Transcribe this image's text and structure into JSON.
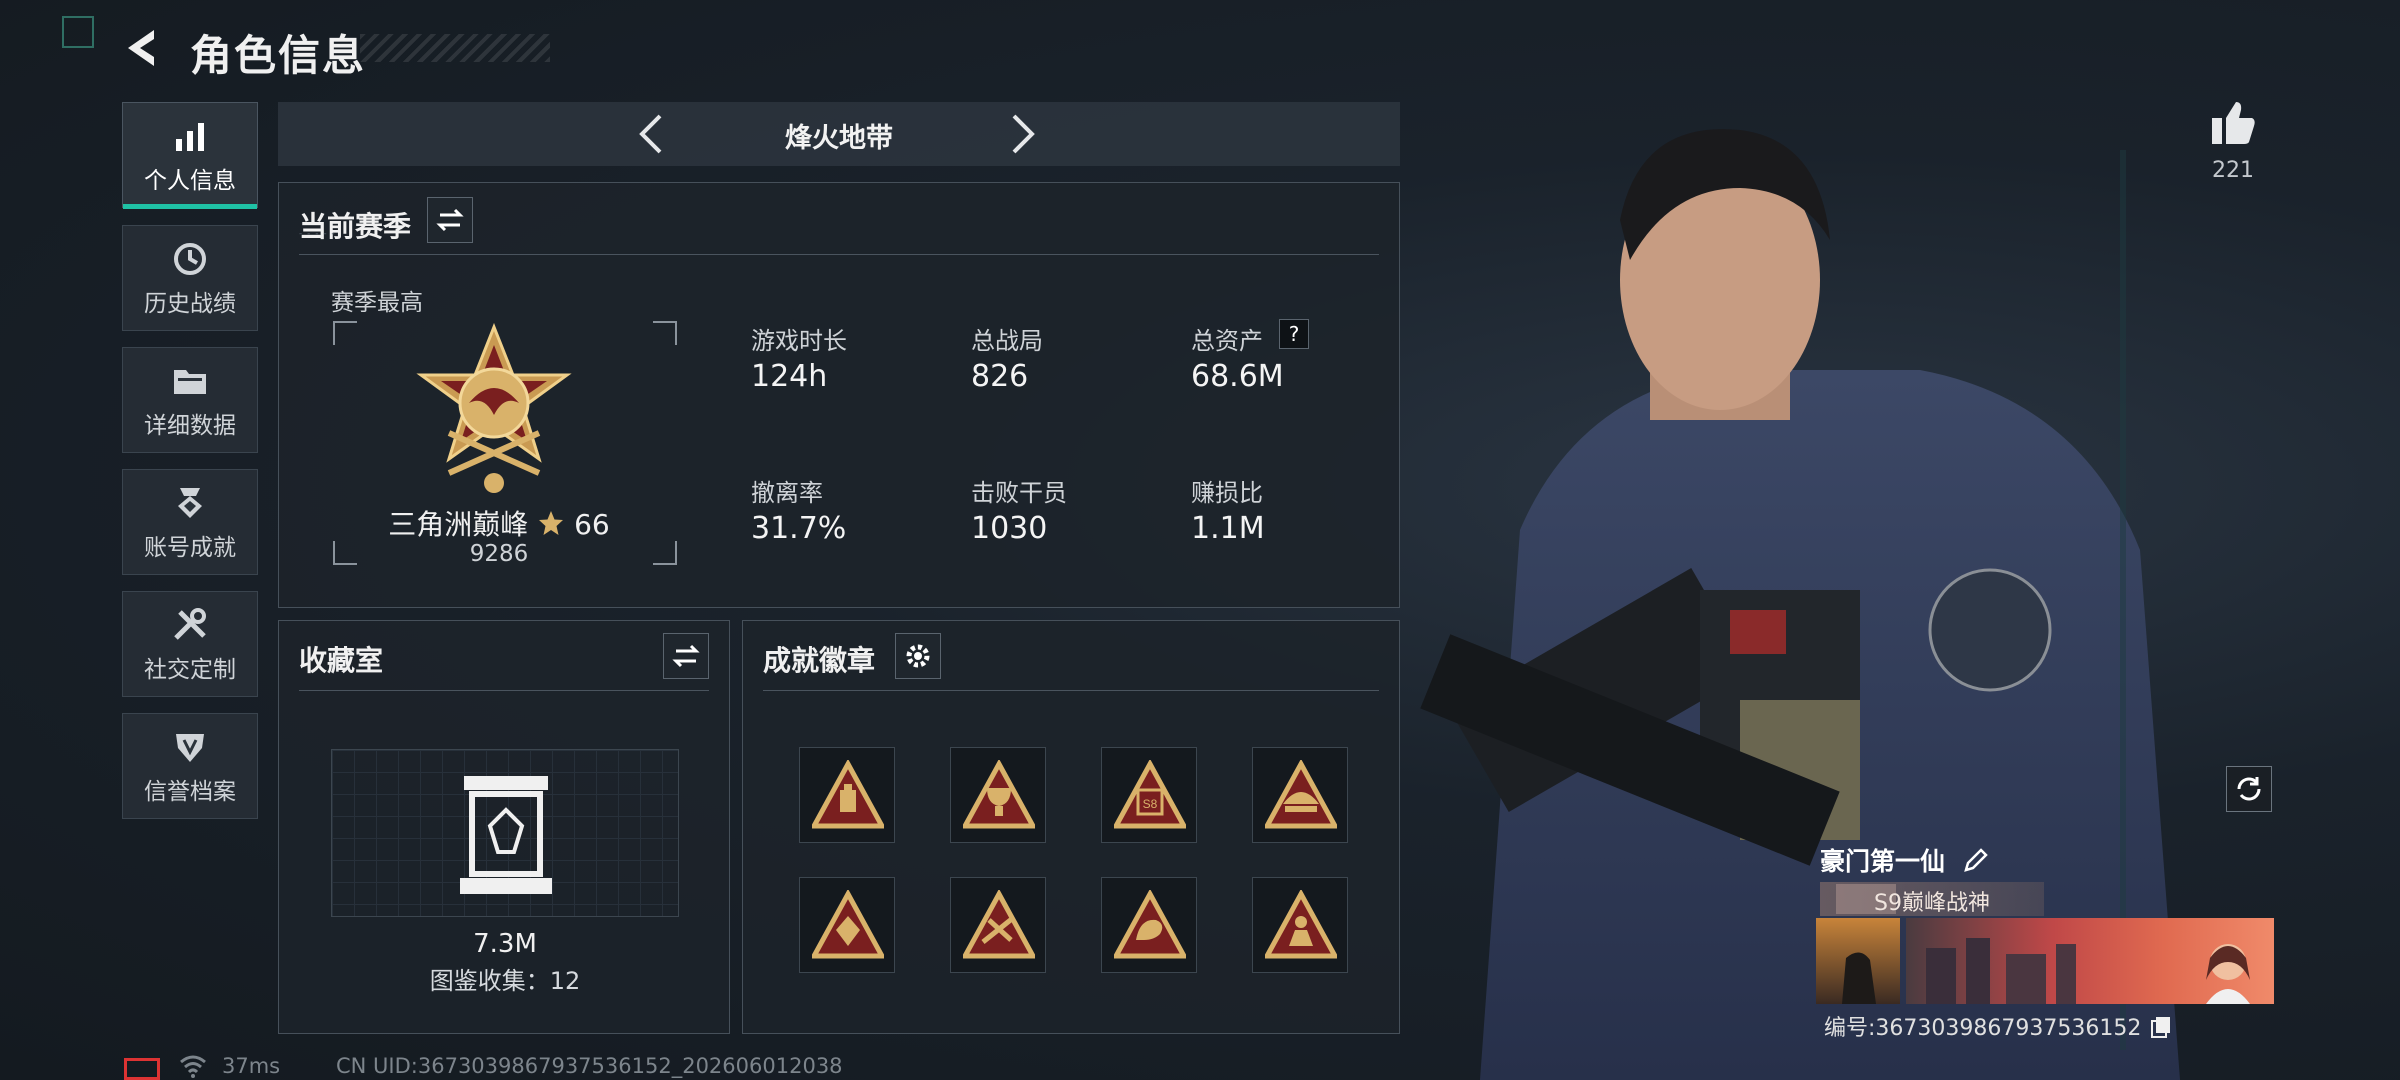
{
  "header": {
    "title": "角色信息"
  },
  "sidebar": {
    "items": [
      {
        "label": "个人信息",
        "icon": "bar-chart-icon",
        "active": true
      },
      {
        "label": "历史战绩",
        "icon": "history-clock-icon"
      },
      {
        "label": "详细数据",
        "icon": "folder-icon"
      },
      {
        "label": "账号成就",
        "icon": "achievement-medal-icon"
      },
      {
        "label": "社交定制",
        "icon": "wrench-tools-icon"
      },
      {
        "label": "信誉档案",
        "icon": "reputation-shield-icon"
      }
    ]
  },
  "mode": {
    "title": "烽火地带"
  },
  "season": {
    "title": "当前赛季",
    "best_label": "赛季最高",
    "rank_name": "三角洲巅峰",
    "rank_stars": "66",
    "rank_score": "9286",
    "stats": [
      {
        "label": "游戏时长",
        "value": "124h"
      },
      {
        "label": "总战局",
        "value": "826"
      },
      {
        "label": "总资产",
        "value": "68.6M"
      },
      {
        "label": "撤离率",
        "value": "31.7%"
      },
      {
        "label": "击败干员",
        "value": "1030"
      },
      {
        "label": "赚损比",
        "value": "1.1M"
      }
    ],
    "help_glyph": "?"
  },
  "collection": {
    "title": "收藏室",
    "value": "7.3M",
    "catalog_label": "图鉴收集：12"
  },
  "badges": {
    "title": "成就徽章",
    "items": [
      "badge-1",
      "badge-2",
      "badge-s8",
      "badge-4",
      "badge-5",
      "badge-6",
      "badge-7",
      "badge-8"
    ],
    "s8_text": "S8"
  },
  "profile": {
    "likes": "221",
    "name": "豪门第一仙",
    "title_tag": "S9巅峰战神",
    "id_label": "编号:3673039867937536152"
  },
  "status_bar": {
    "ping": "37ms",
    "uid": "CN UID:3673039867937536152_202606012038"
  },
  "colors": {
    "accent": "#1fc2a5",
    "gold": "#d9b26a",
    "badge_red": "#7a1f1f"
  }
}
